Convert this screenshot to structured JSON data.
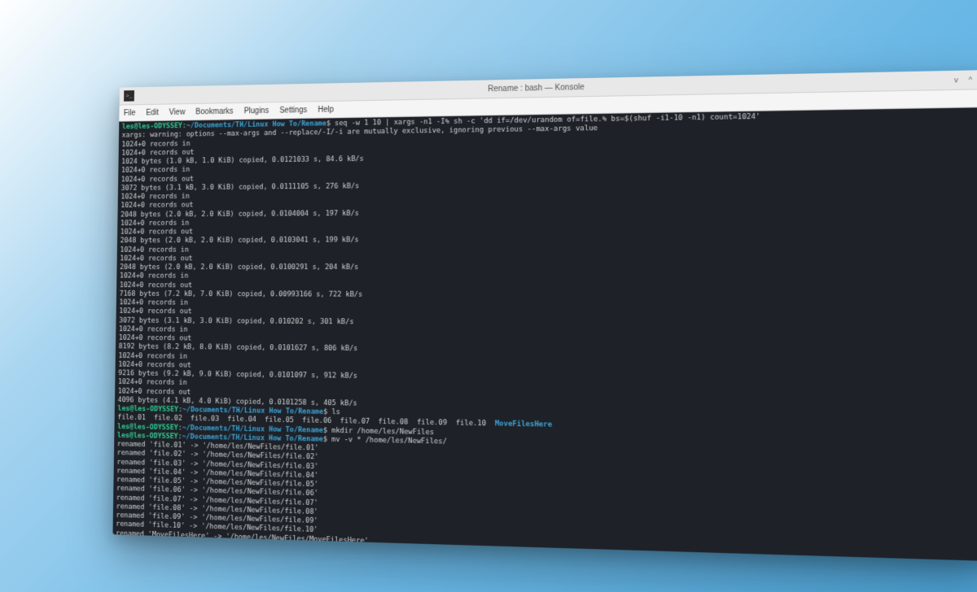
{
  "window": {
    "title": "Rename : bash — Konsole",
    "app_icon_glyph": ">_"
  },
  "menubar": {
    "file": "File",
    "edit": "Edit",
    "view": "View",
    "bookmarks": "Bookmarks",
    "plugins": "Plugins",
    "settings": "Settings",
    "help": "Help"
  },
  "window_controls": {
    "min_glyph": "v",
    "max_glyph": "^",
    "close_glyph": "×"
  },
  "prompt": {
    "user_host": "les@les-ODYSSEY",
    "sep1": ":",
    "path": "~/Documents/TH/Linux How To/Rename",
    "sigil": "$"
  },
  "commands": {
    "cmd1": "seq -w 1 10 | xargs -n1 -I% sh -c 'dd if=/dev/urandom of=file.% bs=$(shuf -i1-10 -n1) count=1024'",
    "cmd2": "ls",
    "cmd3": "mkdir /home/les/NewFiles",
    "cmd4": "mv -v * /home/les/NewFiles/",
    "cmd5": ""
  },
  "xargs_warning": "xargs: warning: options --max-args and --replace/-I/-i are mutually exclusive, ignoring previous --max-args value",
  "rec_in": "1024+0 records in",
  "rec_out": "1024+0 records out",
  "dd_summaries": [
    "1024 bytes (1.0 kB, 1.0 KiB) copied, 0.0121033 s, 84.6 kB/s",
    "3072 bytes (3.1 kB, 3.0 KiB) copied, 0.0111105 s, 276 kB/s",
    "2048 bytes (2.0 kB, 2.0 KiB) copied, 0.0104004 s, 197 kB/s",
    "2048 bytes (2.0 kB, 2.0 KiB) copied, 0.0103041 s, 199 kB/s",
    "2048 bytes (2.0 kB, 2.0 KiB) copied, 0.0100291 s, 204 kB/s",
    "7168 bytes (7.2 kB, 7.0 KiB) copied, 0.00993166 s, 722 kB/s",
    "3072 bytes (3.1 kB, 3.0 KiB) copied, 0.010202 s, 301 kB/s",
    "8192 bytes (8.2 kB, 8.0 KiB) copied, 0.0101627 s, 806 kB/s",
    "9216 bytes (9.2 kB, 9.0 KiB) copied, 0.0101097 s, 912 kB/s",
    "4096 bytes (4.1 kB, 4.0 KiB) copied, 0.0101258 s, 405 kB/s"
  ],
  "ls_output": {
    "files_text": "file.01  file.02  file.03  file.04  file.05  file.06  file.07  file.08  file.09  file.10  ",
    "dir_text": "MoveFilesHere"
  },
  "mv_output": [
    "renamed 'file.01' -> '/home/les/NewFiles/file.01'",
    "renamed 'file.02' -> '/home/les/NewFiles/file.02'",
    "renamed 'file.03' -> '/home/les/NewFiles/file.03'",
    "renamed 'file.04' -> '/home/les/NewFiles/file.04'",
    "renamed 'file.05' -> '/home/les/NewFiles/file.05'",
    "renamed 'file.06' -> '/home/les/NewFiles/file.06'",
    "renamed 'file.07' -> '/home/les/NewFiles/file.07'",
    "renamed 'file.08' -> '/home/les/NewFiles/file.08'",
    "renamed 'file.09' -> '/home/les/NewFiles/file.09'",
    "renamed 'file.10' -> '/home/les/NewFiles/file.10'",
    "renamed 'MoveFilesHere' -> '/home/les/NewFiles/MoveFilesHere'"
  ]
}
